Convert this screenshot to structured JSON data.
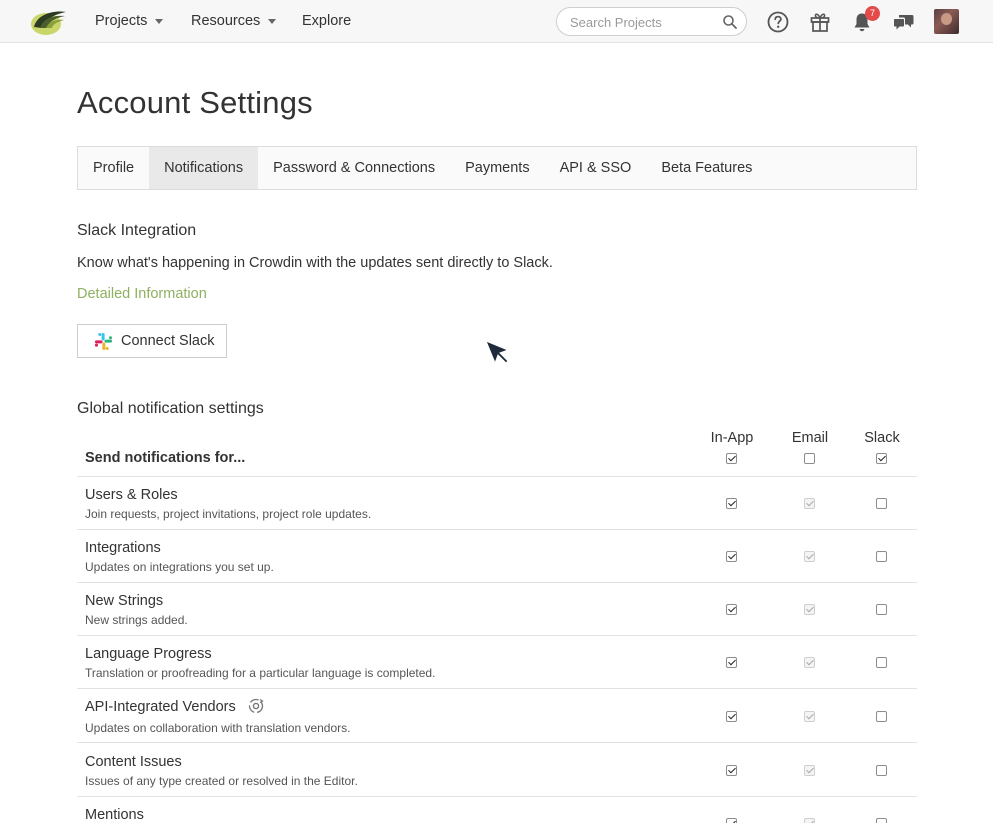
{
  "header": {
    "nav": [
      {
        "label": "Projects",
        "has_caret": true
      },
      {
        "label": "Resources",
        "has_caret": true
      },
      {
        "label": "Explore",
        "has_caret": false
      }
    ],
    "search": {
      "placeholder": "Search Projects",
      "value": ""
    },
    "notification_count": "7",
    "icons": [
      "help-icon",
      "gift-icon",
      "bell-icon",
      "chat-icon"
    ]
  },
  "page": {
    "title": "Account Settings",
    "tabs": [
      {
        "label": "Profile",
        "active": false
      },
      {
        "label": "Notifications",
        "active": true
      },
      {
        "label": "Password & Connections",
        "active": false
      },
      {
        "label": "Payments",
        "active": false
      },
      {
        "label": "API & SSO",
        "active": false
      },
      {
        "label": "Beta Features",
        "active": false
      }
    ]
  },
  "slack": {
    "heading": "Slack Integration",
    "description": "Know what's happening in Crowdin with the updates sent directly to Slack.",
    "link": "Detailed Information",
    "button": "Connect Slack"
  },
  "notifications": {
    "heading": "Global notification settings",
    "columns": [
      "In-App",
      "Email",
      "Slack"
    ],
    "send_label": "Send notifications for...",
    "header_checks": {
      "in_app": true,
      "email": false,
      "slack": true
    },
    "rows": [
      {
        "title": "Users & Roles",
        "desc": "Join requests, project invitations, project role updates.",
        "in_app": true,
        "email": true,
        "slack": false
      },
      {
        "title": "Integrations",
        "desc": "Updates on integrations you set up.",
        "in_app": true,
        "email": true,
        "slack": false
      },
      {
        "title": "New Strings",
        "desc": "New strings added.",
        "in_app": true,
        "email": true,
        "slack": false
      },
      {
        "title": "Language Progress",
        "desc": "Translation or proofreading for a particular language is completed.",
        "in_app": true,
        "email": true,
        "slack": false
      },
      {
        "title": "API-Integrated Vendors",
        "desc": "Updates on collaboration with translation vendors.",
        "in_app": true,
        "email": true,
        "slack": false
      },
      {
        "title": "Content Issues",
        "desc": "Issues of any type created or resolved in the Editor.",
        "in_app": true,
        "email": true,
        "slack": false
      },
      {
        "title": "Mentions",
        "desc": "",
        "in_app": true,
        "email": true,
        "slack": false
      }
    ]
  }
}
